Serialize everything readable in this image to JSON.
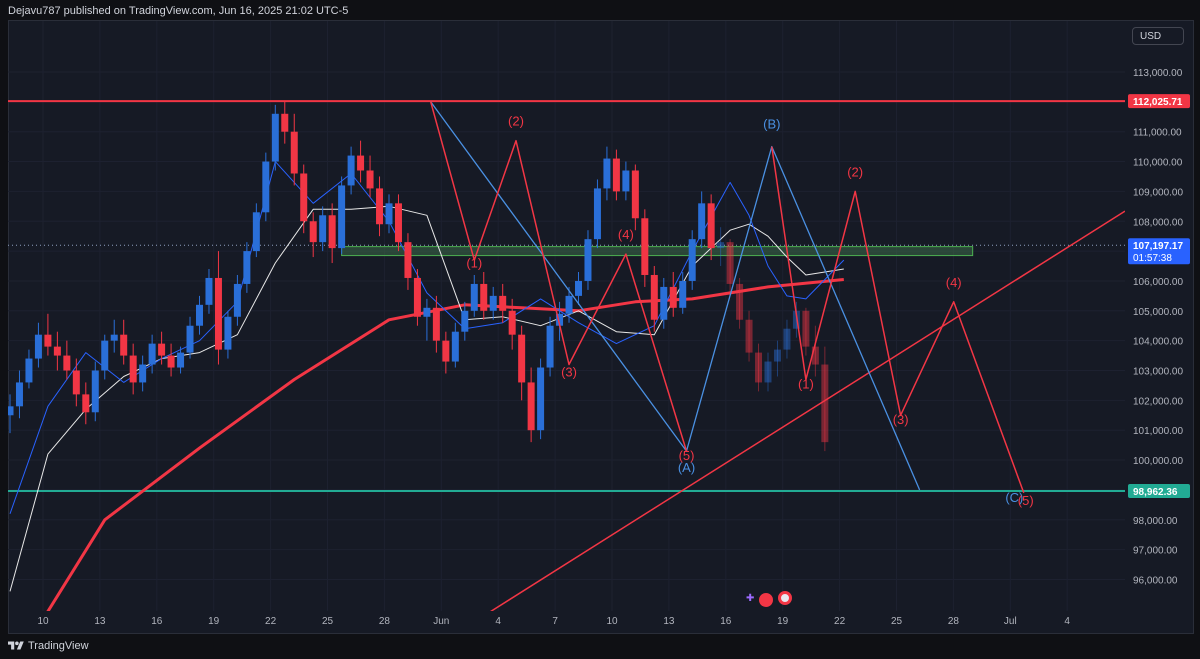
{
  "credit": "Dejavu787 published on TradingView.com, Jun 16, 2025 21:02 UTC-5",
  "currency": "USD",
  "footer": {
    "brand": "TradingView"
  },
  "colors": {
    "background": "#161a25",
    "candle_up": "#2a6fd8",
    "candle_down": "#f23645",
    "resistance": "#f23645",
    "support": "#22ab94",
    "wave_red": "#f23645",
    "wave_blue": "#4a90e2",
    "ma_long": "#f23645",
    "ma_white": "#e8e8e8",
    "ma_blue": "#2962ff",
    "zone_fill": "#3d6b49"
  },
  "chart_data": {
    "type": "line",
    "symbol_note": "Bitcoin-style price chart with Elliott wave annotations",
    "x_ticks": [
      "10",
      "13",
      "16",
      "19",
      "22",
      "25",
      "28",
      "Jun",
      "4",
      "7",
      "10",
      "13",
      "16",
      "19",
      "22",
      "25",
      "28",
      "Jul",
      "4"
    ],
    "y_ticks": [
      "113,000.00",
      "112,000.00",
      "111,000.00",
      "110,000.00",
      "109,000.00",
      "108,000.00",
      "107,000.00",
      "106,000.00",
      "105,000.00",
      "104,000.00",
      "103,000.00",
      "102,000.00",
      "101,000.00",
      "100,000.00",
      "99,000.00",
      "98,000.00",
      "97,000.00",
      "96,000.00"
    ],
    "ylim": [
      95400,
      113800
    ],
    "price_labels": [
      {
        "name": "resistance",
        "price": 112025.71,
        "text": "112,025.71"
      },
      {
        "name": "current",
        "price": 107197.17,
        "text": "107,197.17",
        "countdown": "01:57:38"
      },
      {
        "name": "support",
        "price": 98962.36,
        "text": "98,962.36"
      }
    ],
    "horizontal_lines": [
      {
        "name": "resistance",
        "price": 112025.71
      },
      {
        "name": "support",
        "price": 98962.36
      }
    ],
    "zone": {
      "price_low": 106850,
      "price_high": 107150,
      "x_start": 17.5,
      "x_end": 50.8
    },
    "trendline": {
      "p1": [
        25.3,
        94900
      ],
      "p2": [
        54,
        106400
      ]
    },
    "blue_path": [
      [
        22.2,
        112000
      ],
      [
        35.7,
        100300
      ],
      [
        40.2,
        110500
      ],
      [
        48,
        99000
      ]
    ],
    "red_wave_1": [
      [
        22.2,
        112000
      ],
      [
        24.5,
        106700
      ],
      [
        26.7,
        110700
      ],
      [
        29.5,
        103200
      ],
      [
        32.5,
        106900
      ],
      [
        35.7,
        100300
      ]
    ],
    "red_wave_2": [
      [
        40.2,
        110500
      ],
      [
        42.0,
        102700
      ],
      [
        44.6,
        109000
      ],
      [
        47.0,
        101500
      ],
      [
        49.8,
        105300
      ],
      [
        53.5,
        98900
      ]
    ],
    "wave_labels": [
      {
        "text": "(1)",
        "x": 24.5,
        "y": 106450,
        "color": "red"
      },
      {
        "text": "(2)",
        "x": 26.7,
        "y": 111200,
        "color": "red"
      },
      {
        "text": "(3)",
        "x": 29.5,
        "y": 102800,
        "color": "red"
      },
      {
        "text": "(4)",
        "x": 32.5,
        "y": 107400,
        "color": "red"
      },
      {
        "text": "(5)",
        "x": 35.7,
        "y": 100000,
        "color": "red"
      },
      {
        "text": "(A)",
        "x": 35.7,
        "y": 99600,
        "color": "blue"
      },
      {
        "text": "(B)",
        "x": 40.2,
        "y": 111100,
        "color": "blue"
      },
      {
        "text": "(1)",
        "x": 42.0,
        "y": 102400,
        "color": "red"
      },
      {
        "text": "(2)",
        "x": 44.6,
        "y": 109500,
        "color": "red"
      },
      {
        "text": "(3)",
        "x": 47.0,
        "y": 101200,
        "color": "red"
      },
      {
        "text": "(4)",
        "x": 49.8,
        "y": 105800,
        "color": "red"
      },
      {
        "text": "(C)",
        "x": 53.0,
        "y": 98600,
        "color": "blue"
      },
      {
        "text": "(5)",
        "x": 53.6,
        "y": 98500,
        "color": "red"
      }
    ],
    "ma_long": [
      [
        0.5,
        93400
      ],
      [
        5,
        98000
      ],
      [
        10,
        100400
      ],
      [
        15,
        102700
      ],
      [
        20,
        104700
      ],
      [
        24,
        105200
      ],
      [
        27,
        105100
      ],
      [
        30,
        105000
      ],
      [
        33,
        105300
      ],
      [
        36,
        105400
      ],
      [
        40,
        105800
      ],
      [
        44,
        106050
      ]
    ],
    "ma_white": [
      [
        0,
        95600
      ],
      [
        2,
        100200
      ],
      [
        4,
        101700
      ],
      [
        6,
        102800
      ],
      [
        8,
        103400
      ],
      [
        10,
        103600
      ],
      [
        12,
        104200
      ],
      [
        14,
        106600
      ],
      [
        16,
        108400
      ],
      [
        18,
        108400
      ],
      [
        20,
        108500
      ],
      [
        22,
        108200
      ],
      [
        24,
        104700
      ],
      [
        26,
        104800
      ],
      [
        28,
        104500
      ],
      [
        30,
        105000
      ],
      [
        32,
        104300
      ],
      [
        34,
        104200
      ],
      [
        36,
        106500
      ],
      [
        38,
        107700
      ],
      [
        39,
        107900
      ],
      [
        40,
        107500
      ],
      [
        41,
        106800
      ],
      [
        42,
        106200
      ],
      [
        44,
        106400
      ]
    ],
    "ma_blue": [
      [
        0,
        98200
      ],
      [
        2,
        101800
      ],
      [
        4,
        103600
      ],
      [
        6,
        102600
      ],
      [
        8,
        103400
      ],
      [
        10,
        104000
      ],
      [
        12,
        105300
      ],
      [
        14,
        110000
      ],
      [
        16,
        108600
      ],
      [
        18,
        109600
      ],
      [
        20,
        108000
      ],
      [
        22,
        105600
      ],
      [
        24,
        104400
      ],
      [
        26,
        104600
      ],
      [
        28,
        105400
      ],
      [
        30,
        104600
      ],
      [
        32,
        103900
      ],
      [
        34,
        104500
      ],
      [
        36,
        107000
      ],
      [
        38,
        109300
      ],
      [
        39,
        108200
      ],
      [
        40,
        106500
      ],
      [
        41,
        105500
      ],
      [
        42,
        105400
      ],
      [
        44,
        106700
      ]
    ],
    "candles": [
      [
        0,
        101500,
        102200,
        100900,
        101800
      ],
      [
        0.5,
        101800,
        103000,
        101400,
        102600
      ],
      [
        1,
        102600,
        103700,
        102400,
        103400
      ],
      [
        1.5,
        103400,
        104600,
        103100,
        104200
      ],
      [
        2,
        104200,
        104900,
        103500,
        103800
      ],
      [
        2.5,
        103800,
        104300,
        103000,
        103500
      ],
      [
        3,
        103500,
        104000,
        102700,
        103000
      ],
      [
        3.5,
        103000,
        103400,
        101800,
        102200
      ],
      [
        4,
        102200,
        102600,
        101200,
        101600
      ],
      [
        4.5,
        101600,
        103300,
        101300,
        103000
      ],
      [
        5,
        103000,
        104200,
        102700,
        104000
      ],
      [
        5.5,
        104000,
        104700,
        103600,
        104200
      ],
      [
        6,
        104200,
        104700,
        103200,
        103500
      ],
      [
        6.5,
        103500,
        103900,
        102200,
        102600
      ],
      [
        7,
        102600,
        103500,
        102300,
        103200
      ],
      [
        7.5,
        103200,
        104200,
        102900,
        103900
      ],
      [
        8,
        103900,
        104300,
        103200,
        103500
      ],
      [
        8.5,
        103500,
        103900,
        102800,
        103100
      ],
      [
        9,
        103100,
        103800,
        102900,
        103600
      ],
      [
        9.5,
        103600,
        104800,
        103400,
        104500
      ],
      [
        10,
        104500,
        105500,
        104200,
        105200
      ],
      [
        10.5,
        105200,
        106400,
        104900,
        106100
      ],
      [
        11,
        106100,
        107000,
        103200,
        103700
      ],
      [
        11.5,
        103700,
        105000,
        103400,
        104800
      ],
      [
        12,
        104800,
        106200,
        104500,
        105900
      ],
      [
        12.5,
        105900,
        107300,
        105600,
        107000
      ],
      [
        13,
        107000,
        108600,
        106800,
        108300
      ],
      [
        13.5,
        108300,
        110300,
        108000,
        110000
      ],
      [
        14,
        110000,
        111900,
        109700,
        111600
      ],
      [
        14.5,
        111600,
        112000,
        110600,
        111000
      ],
      [
        15,
        111000,
        111600,
        109200,
        109600
      ],
      [
        15.5,
        109600,
        109900,
        107600,
        108000
      ],
      [
        16,
        108000,
        108300,
        106800,
        107300
      ],
      [
        16.5,
        107300,
        108500,
        107000,
        108200
      ],
      [
        17,
        108200,
        108600,
        106600,
        107100
      ],
      [
        17.5,
        107100,
        109500,
        106900,
        109200
      ],
      [
        18,
        109200,
        110500,
        108900,
        110200
      ],
      [
        18.5,
        110200,
        110700,
        109300,
        109700
      ],
      [
        19,
        109700,
        110200,
        108800,
        109100
      ],
      [
        19.5,
        109100,
        109500,
        107500,
        107900
      ],
      [
        20,
        107900,
        108900,
        107600,
        108600
      ],
      [
        20.5,
        108600,
        108900,
        107000,
        107300
      ],
      [
        21,
        107300,
        107600,
        105700,
        106100
      ],
      [
        21.5,
        106100,
        106400,
        104500,
        104800
      ],
      [
        22,
        104800,
        105400,
        104000,
        105100
      ],
      [
        22.5,
        105100,
        105500,
        103600,
        104000
      ],
      [
        23,
        104000,
        104300,
        102900,
        103300
      ],
      [
        23.5,
        103300,
        104600,
        103100,
        104300
      ],
      [
        24,
        104300,
        105300,
        104000,
        105000
      ],
      [
        24.5,
        105000,
        106200,
        104800,
        105900
      ],
      [
        25,
        105900,
        106300,
        104700,
        105000
      ],
      [
        25.5,
        105000,
        105800,
        104700,
        105500
      ],
      [
        26,
        105500,
        105900,
        104600,
        105000
      ],
      [
        26.5,
        105000,
        105400,
        103700,
        104200
      ],
      [
        27,
        104200,
        104500,
        102000,
        102600
      ],
      [
        27.5,
        102600,
        103100,
        100600,
        101000
      ],
      [
        28,
        101000,
        103400,
        100700,
        103100
      ],
      [
        28.5,
        103100,
        104800,
        102800,
        104500
      ],
      [
        29,
        104500,
        105300,
        104000,
        104900
      ],
      [
        29.5,
        104900,
        105800,
        104600,
        105500
      ],
      [
        30,
        105500,
        106300,
        105200,
        106000
      ],
      [
        30.5,
        106000,
        107700,
        105700,
        107400
      ],
      [
        31,
        107400,
        109400,
        107100,
        109100
      ],
      [
        31.5,
        109100,
        110500,
        108700,
        110100
      ],
      [
        32,
        110100,
        110400,
        108700,
        109000
      ],
      [
        32.5,
        109000,
        110000,
        108700,
        109700
      ],
      [
        33,
        109700,
        109900,
        107700,
        108100
      ],
      [
        33.5,
        108100,
        108400,
        105800,
        106200
      ],
      [
        34,
        106200,
        106500,
        104300,
        104700
      ],
      [
        34.5,
        104700,
        106100,
        104400,
        105800
      ],
      [
        35,
        105800,
        106300,
        104800,
        105100
      ],
      [
        35.5,
        105100,
        106300,
        104900,
        106000
      ],
      [
        36,
        106000,
        107700,
        105700,
        107400
      ],
      [
        36.5,
        107400,
        109000,
        107100,
        108600
      ],
      [
        37,
        108600,
        108900,
        106700,
        107100
      ]
    ],
    "projection_candles": [
      [
        37.5,
        107100,
        107800,
        106500,
        107300
      ],
      [
        38,
        107300,
        107400,
        105600,
        105900
      ],
      [
        38.5,
        105900,
        106100,
        104400,
        104700
      ],
      [
        39,
        104700,
        105000,
        103300,
        103600
      ],
      [
        39.5,
        103600,
        103900,
        102300,
        102600
      ],
      [
        40,
        102600,
        103600,
        102300,
        103300
      ],
      [
        40.5,
        103300,
        104000,
        102800,
        103700
      ],
      [
        41,
        103700,
        104700,
        103400,
        104400
      ],
      [
        41.5,
        104400,
        105300,
        104100,
        105000
      ],
      [
        42,
        105000,
        105100,
        103500,
        103800
      ],
      [
        42.5,
        103800,
        104500,
        102800,
        103200
      ],
      [
        43,
        103200,
        103800,
        100300,
        100600
      ]
    ]
  }
}
